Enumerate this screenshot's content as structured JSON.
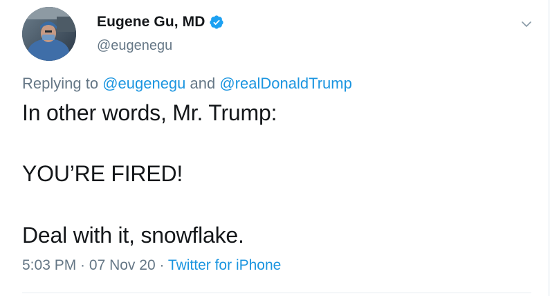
{
  "author": {
    "name": "Eugene Gu, MD",
    "handle": "@eugenegu",
    "verified": true
  },
  "reply": {
    "prefix": "Replying to ",
    "mention_1": "@eugenegu",
    "joiner": " and ",
    "mention_2": "@realDonaldTrump"
  },
  "tweet_lines": {
    "line_1": "In other words, Mr. Trump:",
    "line_2": "YOU’RE FIRED!",
    "line_3": "Deal with it, snowflake."
  },
  "meta": {
    "time": "5:03 PM",
    "sep_1": " · ",
    "date": "07 Nov 20",
    "sep_2": " · ",
    "source": "Twitter for iPhone"
  },
  "colors": {
    "link": "#1b95e0",
    "secondary_text": "#657786",
    "primary_text": "#14171a",
    "verified_badge": "#1da1f2"
  },
  "icons": {
    "verified": "verified-badge-icon",
    "menu": "chevron-down-icon"
  }
}
